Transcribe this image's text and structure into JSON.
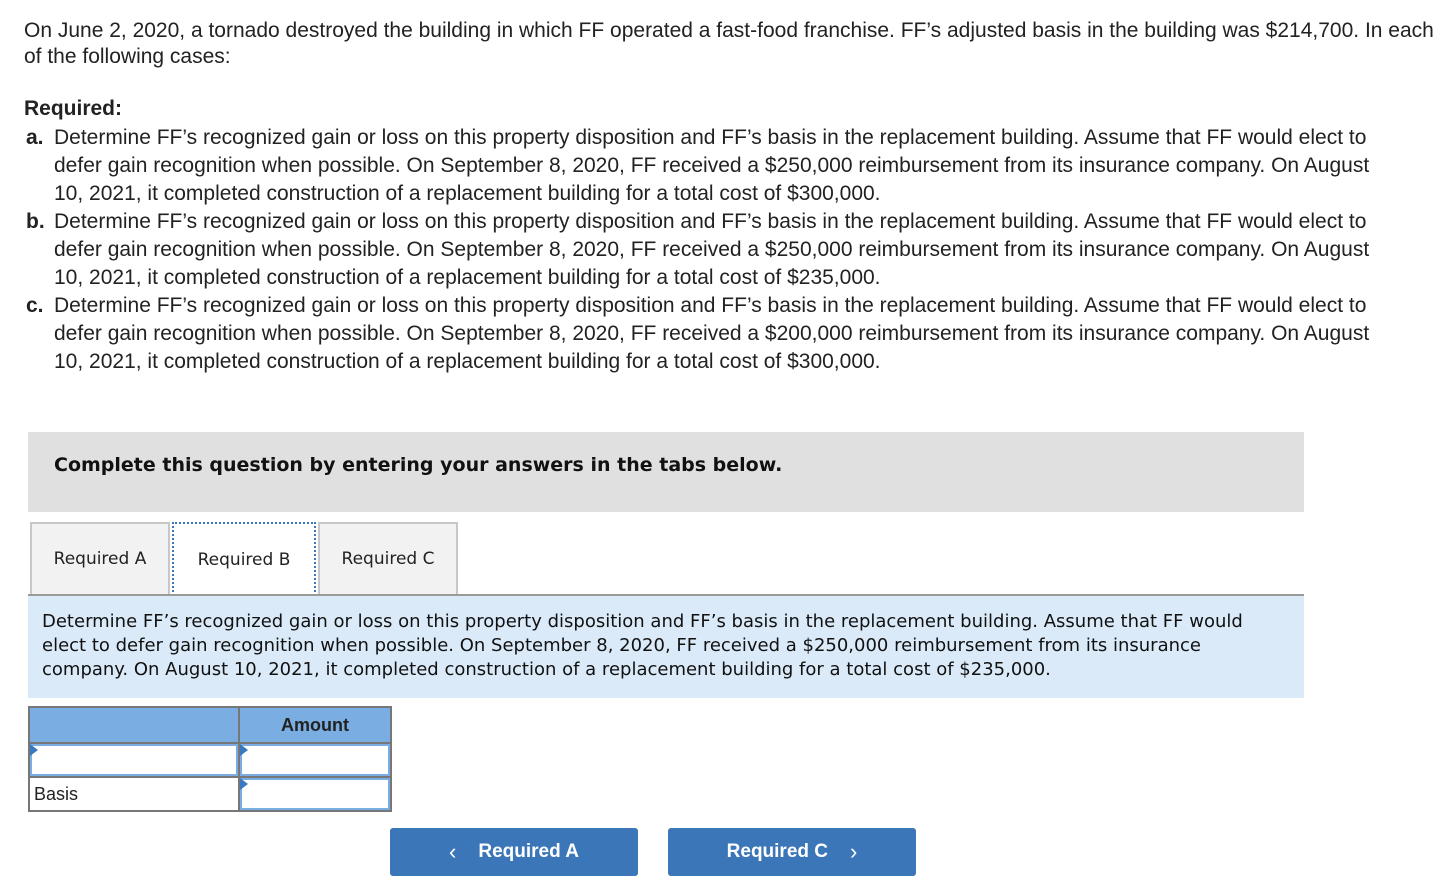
{
  "intro": "On June 2, 2020, a tornado destroyed the building in which FF operated a fast-food franchise. FF’s adjusted basis in the building was $214,700. In each of the following cases:",
  "required_title": "Required:",
  "requirements": [
    {
      "letter": "a.",
      "text": "Determine FF’s recognized gain or loss on this property disposition and FF’s basis in the replacement building. Assume that FF would elect to defer gain recognition when possible. On September 8, 2020, FF received a $250,000 reimbursement from its insurance company. On August 10, 2021, it completed construction of a replacement building for a total cost of $300,000."
    },
    {
      "letter": "b.",
      "text": "Determine FF’s recognized gain or loss on this property disposition and FF’s basis in the replacement building. Assume that FF would elect to defer gain recognition when possible. On September 8, 2020, FF received a $250,000 reimbursement from its insurance company. On August 10, 2021, it completed construction of a replacement building for a total cost of $235,000."
    },
    {
      "letter": "c.",
      "text": "Determine FF’s recognized gain or loss on this property disposition and FF’s basis in the replacement building. Assume that FF would elect to defer gain recognition when possible. On September 8, 2020, FF received a $200,000 reimbursement from its insurance company. On August 10, 2021, it completed construction of a replacement building for a total cost of $300,000."
    }
  ],
  "banner": "Complete this question by entering your answers in the tabs below.",
  "tabs": [
    {
      "label": "Required A",
      "active": false
    },
    {
      "label": "Required B",
      "active": true
    },
    {
      "label": "Required C",
      "active": false
    }
  ],
  "instructions": "Determine FF’s recognized gain or loss on this property disposition and FF’s basis in the replacement building. Assume that FF would elect to defer gain recognition when possible. On September 8, 2020, FF received a $250,000 reimbursement from its insurance company. On August 10, 2021, it completed construction of a replacement building for a total cost of $235,000.",
  "table": {
    "header": {
      "label": "",
      "amount": "Amount"
    },
    "rows": [
      {
        "label": "",
        "label_input": true,
        "amount": ""
      },
      {
        "label": "Basis",
        "label_input": false,
        "amount": ""
      }
    ]
  },
  "nav": {
    "prev_label": "Required A",
    "next_label": "Required C",
    "prev_icon": "‹",
    "next_icon": "›"
  },
  "colors": {
    "accent": "#3b77b8",
    "header_blue": "#7aaee2",
    "instruction_bg": "#dbeaf8",
    "banner_bg": "#e0e0e0"
  }
}
